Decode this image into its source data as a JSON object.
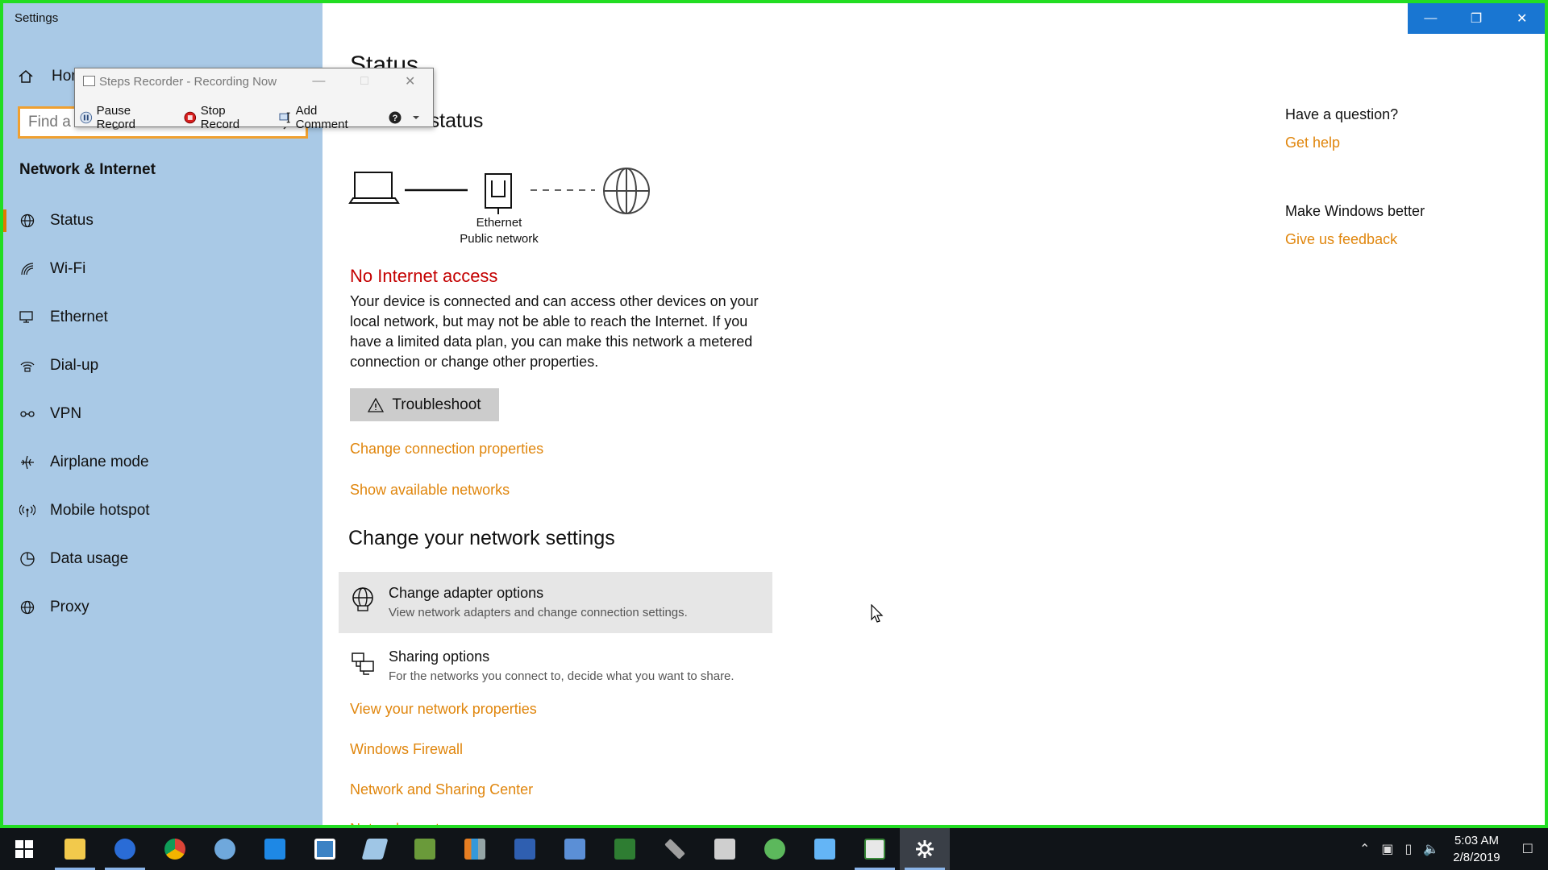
{
  "app": {
    "title": "Settings"
  },
  "sidebar": {
    "home_label": "Home",
    "search_placeholder": "Find a setting",
    "section_heading": "Network & Internet",
    "items": [
      {
        "label": "Status",
        "icon": "globe-icon"
      },
      {
        "label": "Wi-Fi",
        "icon": "wifi-icon"
      },
      {
        "label": "Ethernet",
        "icon": "ethernet-icon"
      },
      {
        "label": "Dial-up",
        "icon": "dialup-icon"
      },
      {
        "label": "VPN",
        "icon": "vpn-icon"
      },
      {
        "label": "Airplane mode",
        "icon": "airplane-icon"
      },
      {
        "label": "Mobile hotspot",
        "icon": "hotspot-icon"
      },
      {
        "label": "Data usage",
        "icon": "data-usage-icon"
      },
      {
        "label": "Proxy",
        "icon": "globe-icon"
      }
    ]
  },
  "main": {
    "page_title": "Status",
    "network_status_title": "Network status",
    "diagram": {
      "adapter": "Ethernet",
      "network_type": "Public network"
    },
    "status_heading": "No Internet access",
    "status_description": "Your device is connected and can access other devices on your local network, but may not be able to reach the Internet. If you have a limited data plan, you can make this network a metered connection or change other properties.",
    "troubleshoot_label": "Troubleshoot",
    "links": {
      "change_connection": "Change connection properties",
      "show_networks": "Show available networks"
    },
    "change_settings_title": "Change your network settings",
    "options": [
      {
        "title": "Change adapter options",
        "desc": "View network adapters and change connection settings."
      },
      {
        "title": "Sharing options",
        "desc": "For the networks you connect to, decide what you want to share."
      }
    ],
    "bottom_links": [
      "View your network properties",
      "Windows Firewall",
      "Network and Sharing Center",
      "Network reset"
    ]
  },
  "right": {
    "question": "Have a question?",
    "help_link": "Get help",
    "better": "Make Windows better",
    "feedback_link": "Give us feedback"
  },
  "steps_recorder": {
    "title": "Steps Recorder - Recording Now",
    "pause": "Pause Record",
    "stop": "Stop Record",
    "comment": "Add Comment"
  },
  "taskbar": {
    "time": "5:03 AM",
    "date": "2/8/2019"
  },
  "colors": {
    "accent": "#e0860d",
    "sidebar_bg": "#a9c9e6",
    "error": "#c40000",
    "titlebar_controls": "#1976d2"
  }
}
